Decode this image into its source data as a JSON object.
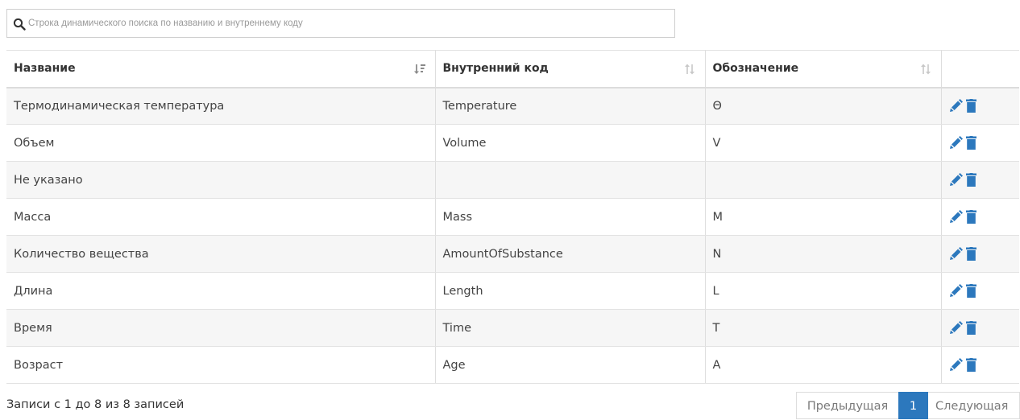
{
  "search": {
    "placeholder": "Строка динамического поиска по названию и внутреннему коду",
    "icon": "search-icon"
  },
  "table": {
    "columns": [
      {
        "label": "Название",
        "sort": "sorted-ascending"
      },
      {
        "label": "Внутренний код",
        "sort": "sortable"
      },
      {
        "label": "Обозначение",
        "sort": "sortable"
      },
      {
        "label": "",
        "sort": "none"
      }
    ],
    "rows": [
      {
        "name": "Термодинамическая температура",
        "code": "Temperature",
        "symbol": "Θ"
      },
      {
        "name": "Объем",
        "code": "Volume",
        "symbol": "V"
      },
      {
        "name": "Не указано",
        "code": "",
        "symbol": ""
      },
      {
        "name": "Масса",
        "code": "Mass",
        "symbol": "M"
      },
      {
        "name": "Количество вещества",
        "code": "AmountOfSubstance",
        "symbol": "N"
      },
      {
        "name": "Длина",
        "code": "Length",
        "symbol": "L"
      },
      {
        "name": "Время",
        "code": "Time",
        "symbol": "T"
      },
      {
        "name": "Возраст",
        "code": "Age",
        "symbol": "A"
      }
    ],
    "row_actions": [
      "edit-icon",
      "trash-icon"
    ]
  },
  "footer": {
    "info": "Записи с 1 до 8 из 8 записей",
    "prev": "Предыдущая",
    "current_page": "1",
    "next": "Следующая"
  },
  "colors": {
    "accent": "#2c78bd",
    "row_stripe": "#f6f6f6",
    "border": "#dedede"
  }
}
